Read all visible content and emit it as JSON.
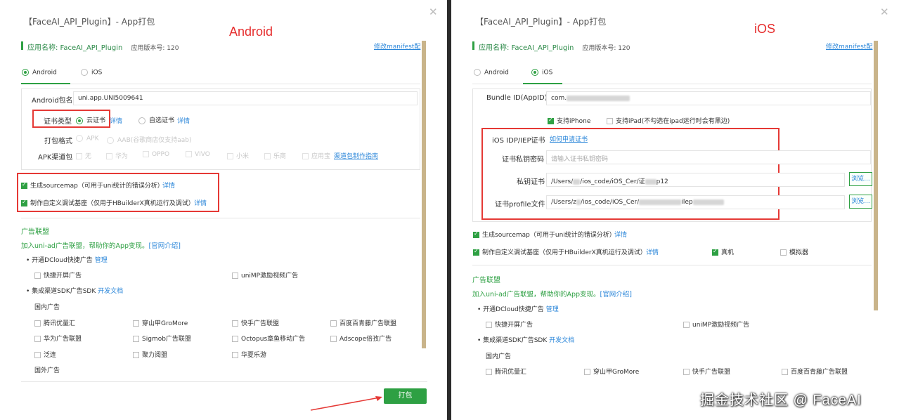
{
  "left": {
    "title": "【FaceAI_API_Plugin】- App打包",
    "label": "Android",
    "app_name": "应用名称: FaceAI_API_Plugin",
    "app_version": "应用版本号: 120",
    "manifest_link": "修改manifest配",
    "tabs": [
      "Android",
      "iOS"
    ],
    "package_label": "Android包名",
    "package_value": "uni.app.UNI5009641",
    "cert_type_label": "证书类型",
    "cert_cloud": "云证书",
    "cert_custom": "自选证书",
    "detail": "详情",
    "pack_format_label": "打包格式",
    "pack_apk": "APK",
    "pack_aab": "AAB(谷歌商店仅支持aab)",
    "channel_label": "APK渠道包",
    "channels": [
      "无",
      "华为",
      "OPPO",
      "VIVO",
      "小米",
      "乐商",
      "应用宝"
    ],
    "channel_guide": "渠道包制作指南",
    "sourcemap": "生成sourcemap（可用于uni统计的错误分析）",
    "custom_base": "制作自定义调试基座（仅用于HBuilderX真机运行及调试）",
    "ad_title": "广告联盟",
    "ad_invite": "加入uni-ad广告联盟，帮助你的App变现。",
    "ad_intro": "[官网介绍]",
    "dcloud_ads": "开通DCloud快捷广告",
    "manage": "管理",
    "quick_splash": "快捷开屏广告",
    "unimp_video": "uniMP激励视频广告",
    "channel_sdk": "集成渠道SDK广告SDK",
    "dev_docs": "开发文档",
    "domestic": "国内广告",
    "ad_items": [
      "腾讯优量汇",
      "穿山甲GroMore",
      "快手广告联盟",
      "百度百青藤广告联盟",
      "华为广告联盟",
      "Sigmob广告联盟",
      "Octopus章鱼移动广告",
      "Adscope倍孜广告",
      "泛连",
      "聚力阅盟",
      "华夏乐游"
    ],
    "overseas": "国外广告",
    "pack_button": "打包"
  },
  "right": {
    "title": "【FaceAI_API_Plugin】- App打包",
    "label": "iOS",
    "app_name": "应用名称: FaceAI_API_Plugin",
    "app_version": "应用版本号: 120",
    "manifest_link": "修改manifest配",
    "tabs": [
      "Android",
      "iOS"
    ],
    "bundle_label": "Bundle ID(AppID)",
    "bundle_value": "com.",
    "support_iphone": "支持iPhone",
    "support_ipad": "支持iPad(不勾选在ipad运行时会有黑边)",
    "idp_label": "iOS IDP/IEP证书",
    "idp_link": "如何申请证书",
    "cert_pwd_label": "证书私钥密码",
    "cert_pwd_placeholder": "请输入证书私钥密码",
    "key_cert_label": "私钥证书",
    "key_cert_prefix": "/Users/",
    "key_cert_mid": "/ios_code/iOS_Cer/证",
    "key_cert_suffix": "p12",
    "profile_label": "证书profile文件",
    "profile_prefix": "/Users/z",
    "profile_mid": "/ios_code/iOS_Cer/",
    "profile_suffix": "ilep",
    "browse": "浏览...",
    "sourcemap": "生成sourcemap（可用于uni统计的错误分析）",
    "custom_base": "制作自定义调试基座（仅用于HBuilderX真机运行及调试）",
    "real_device": "真机",
    "simulator": "模拟器",
    "detail": "详情",
    "ad_title": "广告联盟",
    "ad_invite": "加入uni-ad广告联盟，帮助你的App变现。",
    "ad_intro": "[官网介绍]",
    "dcloud_ads": "开通DCloud快捷广告",
    "manage": "管理",
    "quick_splash": "快捷开屏广告",
    "unimp_video": "uniMP激励视频广告",
    "channel_sdk": "集成渠道SDK广告SDK",
    "dev_docs": "开发文档",
    "domestic": "国内广告",
    "ad_items": [
      "腾讯优量汇",
      "穿山甲GroMore",
      "快手广告联盟",
      "百度百青藤广告联盟"
    ]
  },
  "watermark": "掘金技术社区 @ FaceAI",
  "colors": {
    "accent": "#2ea043",
    "link": "#2a86d9",
    "highlight": "#e53935"
  }
}
